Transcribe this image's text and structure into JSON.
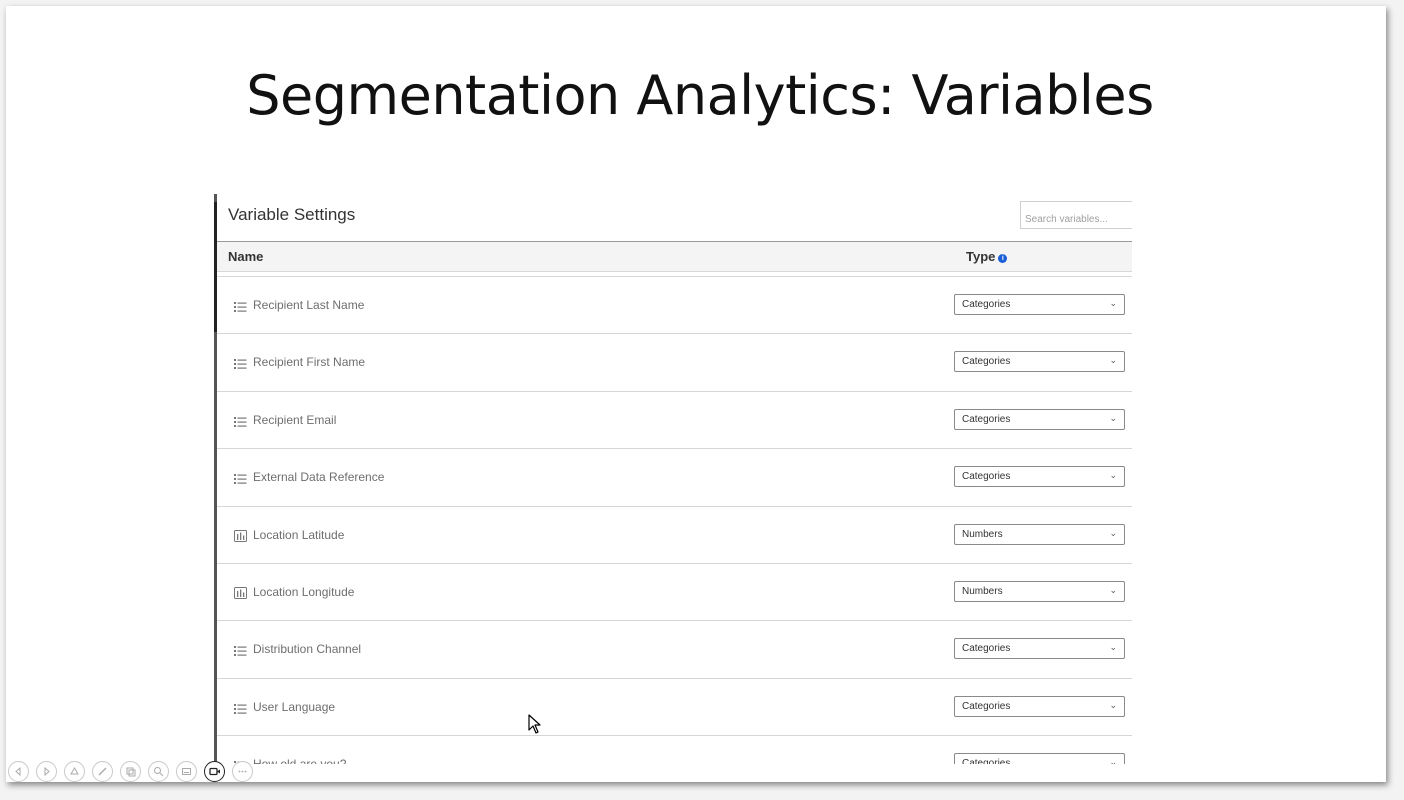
{
  "slide": {
    "title": "Segmentation Analytics: Variables"
  },
  "panel": {
    "title": "Variable Settings",
    "search_placeholder": "Search variables...",
    "columns": {
      "name": "Name",
      "type": "Type"
    },
    "info_icon": "info-icon"
  },
  "rows": [
    {
      "icon": "list-icon",
      "label": "Recipient Last Name",
      "type": "Categories"
    },
    {
      "icon": "list-icon",
      "label": "Recipient First Name",
      "type": "Categories"
    },
    {
      "icon": "list-icon",
      "label": "Recipient Email",
      "type": "Categories"
    },
    {
      "icon": "list-icon",
      "label": "External Data Reference",
      "type": "Categories"
    },
    {
      "icon": "bar-chart-icon",
      "label": "Location Latitude",
      "type": "Numbers"
    },
    {
      "icon": "bar-chart-icon",
      "label": "Location Longitude",
      "type": "Numbers"
    },
    {
      "icon": "list-icon",
      "label": "Distribution Channel",
      "type": "Categories"
    },
    {
      "icon": "list-icon",
      "label": "User Language",
      "type": "Categories"
    },
    {
      "icon": "list-icon",
      "label": "How old are you?",
      "type": "Categories"
    }
  ],
  "toolbar": {
    "buttons": [
      "previous-icon",
      "next-icon",
      "pen-icon",
      "edit-icon",
      "slides-icon",
      "zoom-icon",
      "subtitles-icon",
      "camera-icon",
      "more-icon"
    ]
  },
  "colors": {
    "accent": "#1a5fd6",
    "text": "#333333",
    "muted_text": "#6e6e6e"
  }
}
